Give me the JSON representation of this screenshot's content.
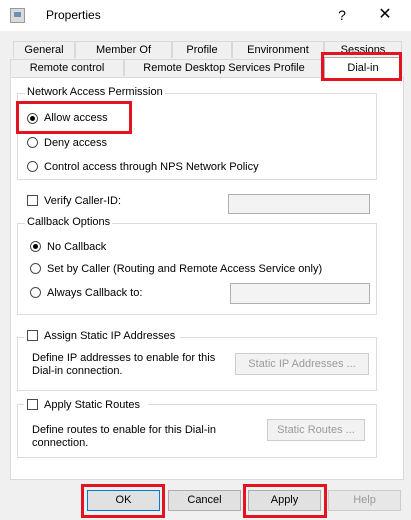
{
  "window": {
    "title": "Properties",
    "help_glyph": "?",
    "close_glyph": "✕"
  },
  "tabs": {
    "row1": [
      "General",
      "Member Of",
      "Profile",
      "Environment",
      "Sessions"
    ],
    "row2": [
      "Remote control",
      "Remote Desktop Services Profile",
      "Dial-in"
    ],
    "active": "Dial-in"
  },
  "network_access": {
    "legend": "Network Access Permission",
    "options": [
      "Allow access",
      "Deny access",
      "Control access through NPS Network Policy"
    ],
    "selected": "Allow access"
  },
  "verify_caller": {
    "label": "Verify Caller-ID:",
    "checked": false,
    "value": ""
  },
  "callback": {
    "legend": "Callback Options",
    "options": [
      "No Callback",
      "Set by Caller (Routing and Remote Access Service only)",
      "Always Callback to:"
    ],
    "selected": "No Callback",
    "always_value": ""
  },
  "static_ip": {
    "label": "Assign Static IP Addresses",
    "checked": false,
    "description_line1": "Define IP addresses to enable for this",
    "description_line2": "Dial-in connection.",
    "button": "Static IP Addresses ..."
  },
  "static_routes": {
    "label": "Apply Static Routes",
    "checked": false,
    "description_line1": "Define routes to enable for this Dial-in",
    "description_line2": "connection.",
    "button": "Static Routes ..."
  },
  "buttons": {
    "ok": "OK",
    "cancel": "Cancel",
    "apply": "Apply",
    "help": "Help"
  },
  "colors": {
    "highlight": "#e3141f",
    "focus_border": "#0078d7",
    "panel": "#ffffff",
    "dialog": "#f0f0f0"
  }
}
